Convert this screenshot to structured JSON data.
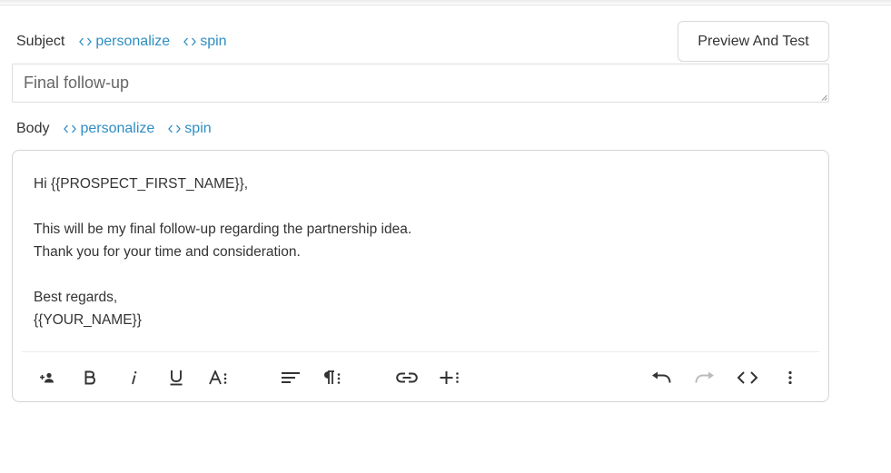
{
  "subject": {
    "label": "Subject",
    "personalize_label": "personalize",
    "spin_label": "spin",
    "value": "Final follow-up"
  },
  "preview_button_label": "Preview And Test",
  "body": {
    "label": "Body",
    "personalize_label": "personalize",
    "spin_label": "spin",
    "lines": [
      "Hi {{PROSPECT_FIRST_NAME}},",
      "",
      "This will be my final follow-up regarding the partnership idea.",
      "Thank you for your time and consideration.",
      "",
      "Best regards,",
      "{{YOUR_NAME}}"
    ]
  },
  "toolbar": {
    "tools": [
      "add-person-icon",
      "bold-icon",
      "italic-icon",
      "underline-icon",
      "text-format-icon",
      "align-left-icon",
      "paragraph-format-icon",
      "link-icon",
      "insert-more-icon",
      "undo-icon",
      "redo-icon",
      "code-view-icon",
      "more-options-icon"
    ],
    "icon_color": "#333333",
    "disabled_icon_color": "#bbbbbb"
  },
  "colors": {
    "link": "#2f8ec2",
    "text": "#333333",
    "border": "#d4d4d4"
  }
}
